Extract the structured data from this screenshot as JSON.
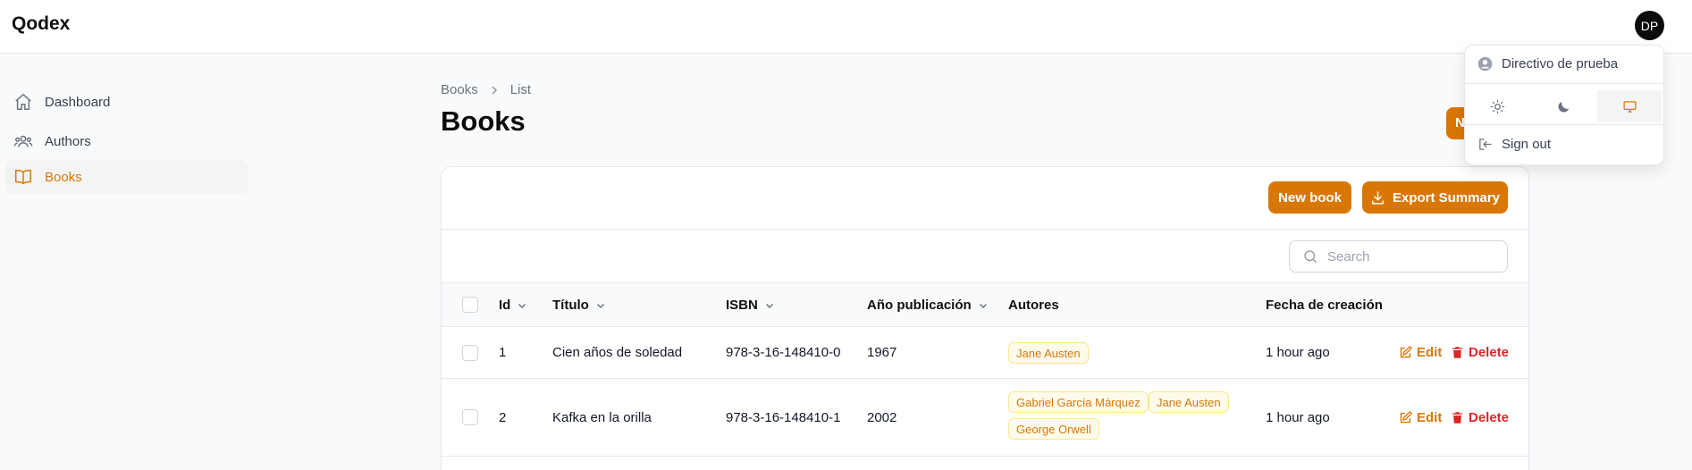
{
  "app": {
    "brand": "Qodex",
    "avatar_initials": "DP"
  },
  "sidebar": {
    "items": [
      {
        "label": "Dashboard",
        "icon": "home-icon",
        "active": false
      },
      {
        "label": "Authors",
        "icon": "users-icon",
        "active": false
      },
      {
        "label": "Books",
        "icon": "book-open-icon",
        "active": true
      }
    ]
  },
  "breadcrumb": {
    "root": "Books",
    "current": "List"
  },
  "page": {
    "title": "Books",
    "header_button_label": "N"
  },
  "toolbar": {
    "new_book_label": "New book",
    "export_label": "Export Summary"
  },
  "search": {
    "placeholder": "Search",
    "value": ""
  },
  "table": {
    "columns": {
      "id": "Id",
      "title": "Título",
      "isbn": "ISBN",
      "year": "Año publicación",
      "authors": "Autores",
      "created": "Fecha de creación"
    },
    "edit_label": "Edit",
    "delete_label": "Delete",
    "rows": [
      {
        "id": "1",
        "title": "Cien años de soledad",
        "isbn": "978-3-16-148410-0",
        "year": "1967",
        "authors": [
          "Jane Austen"
        ],
        "created": "1 hour ago"
      },
      {
        "id": "2",
        "title": "Kafka en la orilla",
        "isbn": "978-3-16-148410-1",
        "year": "2002",
        "authors": [
          "Gabriel García Márquez",
          "Jane Austen",
          "George Orwell"
        ],
        "created": "1 hour ago"
      }
    ]
  },
  "user_menu": {
    "user_name": "Directivo de prueba",
    "theme_options": [
      "light-theme",
      "dark-theme",
      "system-theme"
    ],
    "active_theme": "system-theme",
    "sign_out_label": "Sign out"
  },
  "colors": {
    "accent": "#d97706",
    "danger": "#dc2626",
    "badge_bg": "#fffbeb"
  }
}
